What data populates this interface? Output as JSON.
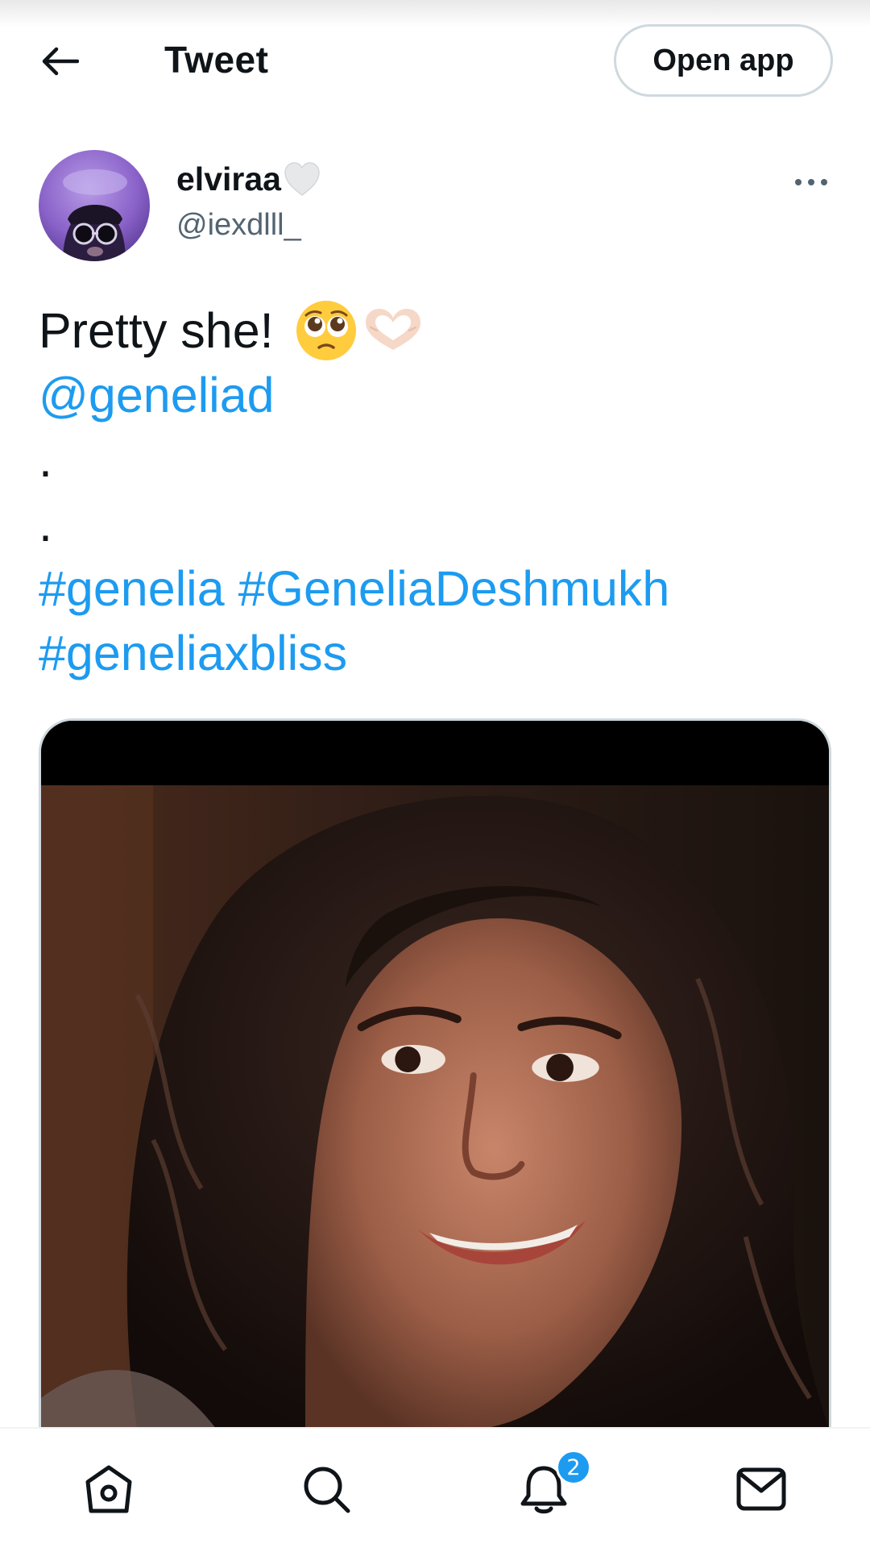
{
  "header": {
    "title": "Tweet",
    "open_app_label": "Open app",
    "back_icon": "arrow-left-icon"
  },
  "author": {
    "display_name": "elviraa",
    "name_emoji": "white-heart-icon",
    "handle": "@iexdlll_",
    "more_icon": "more-icon"
  },
  "tweet": {
    "text": "Pretty she!",
    "emojis": [
      "pleading-face-emoji",
      "heart-hands-emoji"
    ],
    "mention": "@geneliad",
    "dot_1": ".",
    "dot_2": ".",
    "hashtag_1": "#genelia",
    "hashtag_2": "#GeneliaDeshmukh",
    "hashtag_3": "#geneliaxbliss"
  },
  "bottom_nav": {
    "items": [
      "home-icon",
      "search-icon",
      "notifications-icon",
      "messages-icon"
    ],
    "notification_count": "2"
  },
  "colors": {
    "accent": "#1d9bf0",
    "text": "#0f1419",
    "secondary_text": "#536471",
    "border": "#cfd9de"
  }
}
